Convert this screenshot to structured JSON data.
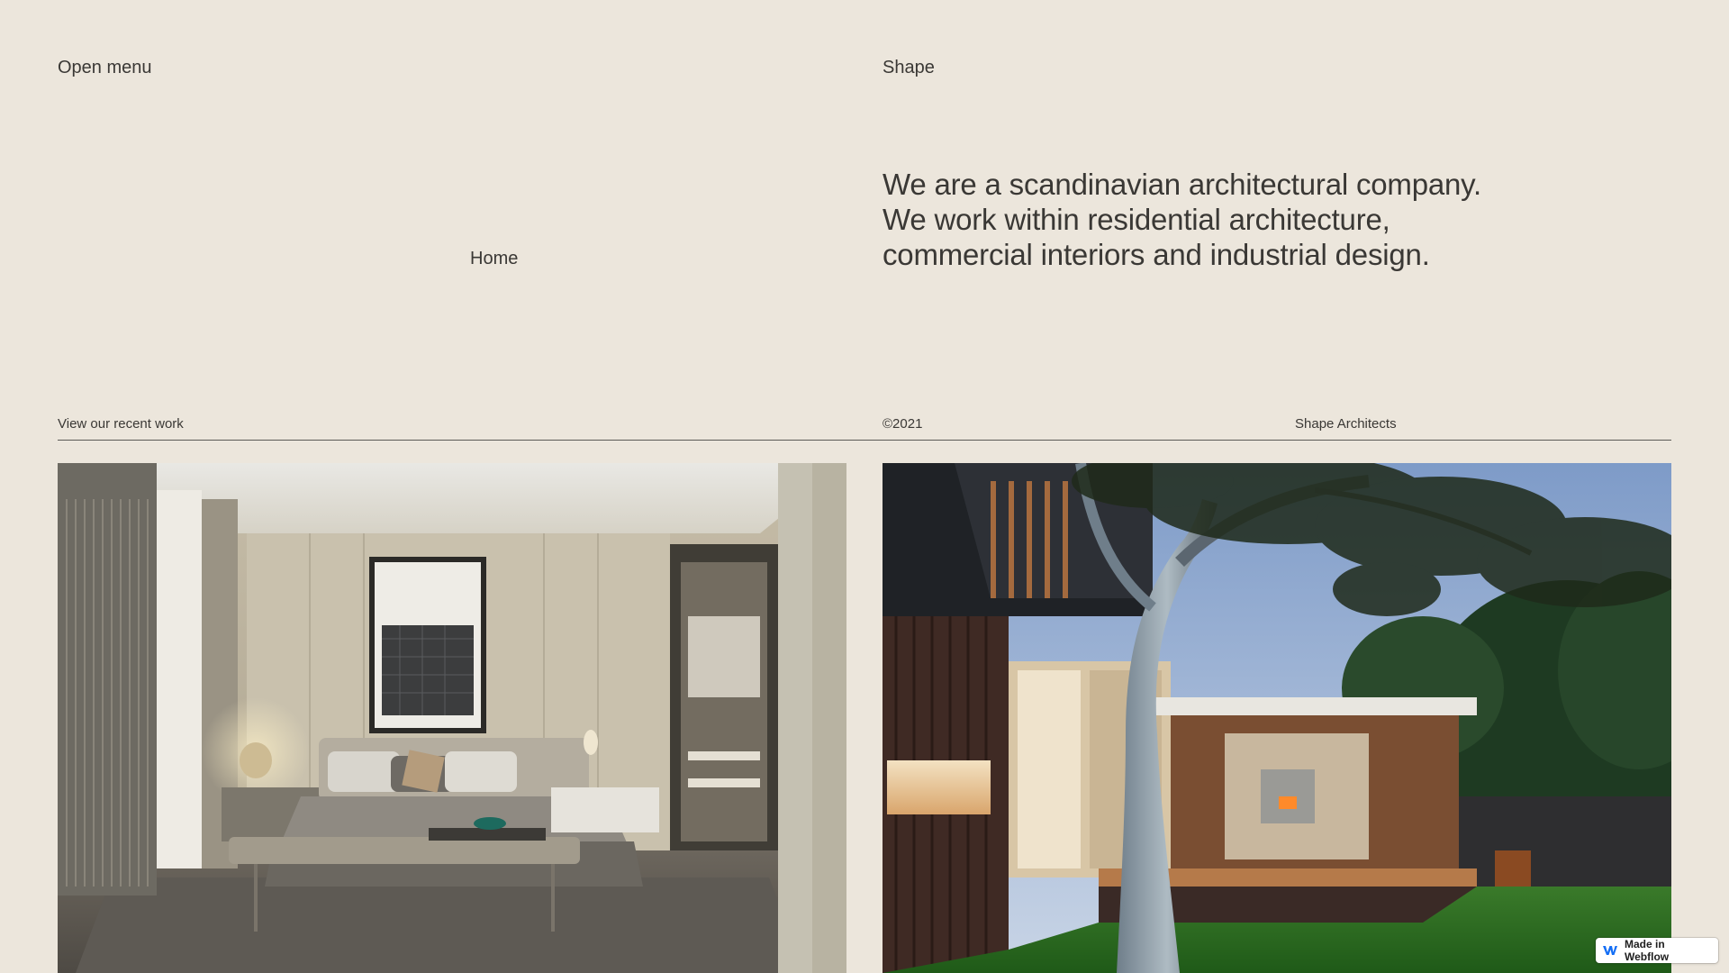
{
  "header": {
    "menu_label": "Open menu",
    "brand": "Shape"
  },
  "nav": {
    "home_label": "Home"
  },
  "intro": {
    "text": "We are a scandinavian architectural company. We work within residential architecture, commercial interiors and industrial design."
  },
  "meta": {
    "recent_work": "View our recent work",
    "copyright": "©2021",
    "company": "Shape Architects"
  },
  "gallery": {
    "images": [
      {
        "subject": "bedroom-interior"
      },
      {
        "subject": "house-exterior-with-tree"
      }
    ]
  },
  "badge": {
    "label": "Made in Webflow",
    "icon": "webflow-icon",
    "color": "#146ef5"
  },
  "colors": {
    "background": "#ece6dc",
    "text": "#3a3835"
  }
}
